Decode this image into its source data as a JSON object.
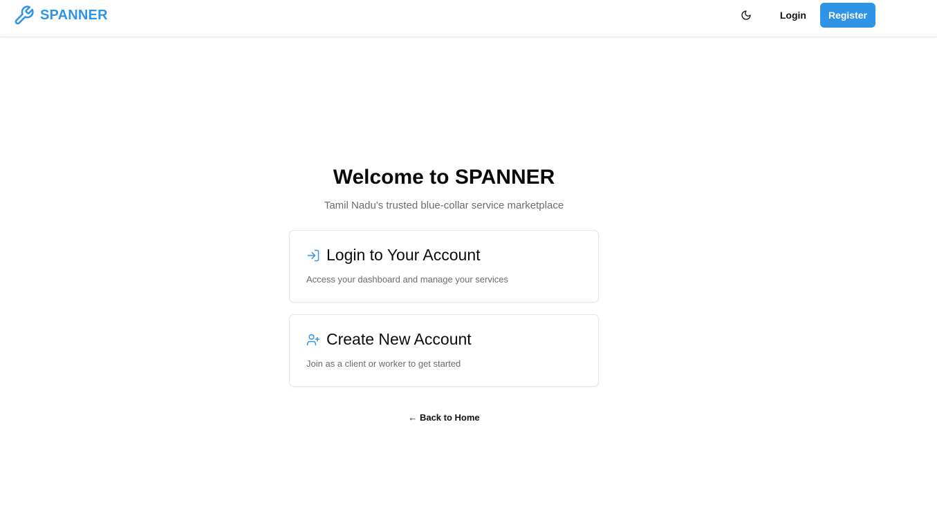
{
  "header": {
    "brand_name": "SPANNER",
    "brand_icon": "wrench-icon",
    "theme_toggle_icon": "moon-icon",
    "login_label": "Login",
    "register_label": "Register"
  },
  "hero": {
    "title": "Welcome to SPANNER",
    "subtitle": "Tamil Nadu's trusted blue-collar service marketplace"
  },
  "cards": [
    {
      "icon": "log-in-icon",
      "title": "Login to Your Account",
      "description": "Access your dashboard and manage your services"
    },
    {
      "icon": "user-plus-icon",
      "title": "Create New Account",
      "description": "Join as a client or worker to get started"
    }
  ],
  "back_link": "← Back to Home",
  "colors": {
    "accent": "#2f93e6",
    "muted_text": "#6b6b6b",
    "border": "#e3e5e8"
  }
}
